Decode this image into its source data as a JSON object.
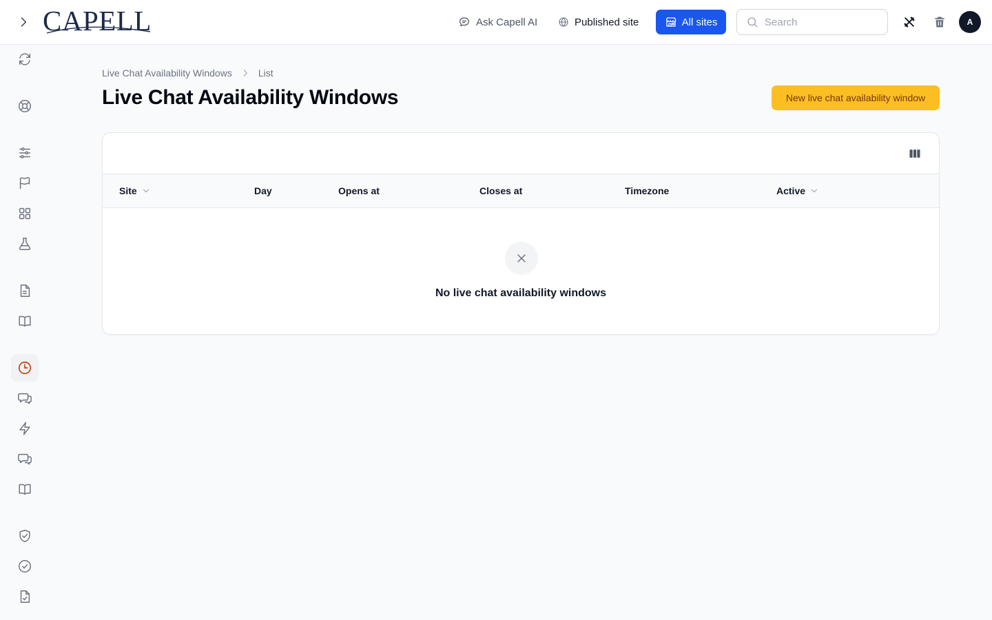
{
  "brand": {
    "logo_text": "CAPELL"
  },
  "topbar": {
    "ask_ai_label": "Ask Capell AI",
    "published_site_label": "Published site",
    "all_sites_label": "All sites",
    "search_placeholder": "Search",
    "search_value": "",
    "avatar_initial": "A",
    "accent_color": "#1a56f0"
  },
  "sidebar": {
    "items": [
      {
        "icon": "refresh-icon",
        "active": false
      },
      {
        "icon": "lifebuoy-icon",
        "active": false
      },
      {
        "icon": "sliders-icon",
        "active": false
      },
      {
        "icon": "flag-icon",
        "active": false
      },
      {
        "icon": "grid-icon",
        "active": false
      },
      {
        "icon": "flask-icon",
        "active": false
      },
      {
        "icon": "document-icon",
        "active": false
      },
      {
        "icon": "book-icon",
        "active": false
      },
      {
        "icon": "clock-icon",
        "active": true
      },
      {
        "icon": "chat-bubbles-icon",
        "active": false
      },
      {
        "icon": "bolt-icon",
        "active": false
      },
      {
        "icon": "chat-bubbles-icon",
        "active": false
      },
      {
        "icon": "book-icon",
        "active": false
      },
      {
        "icon": "shield-check-icon",
        "active": false
      },
      {
        "icon": "check-circle-icon",
        "active": false
      },
      {
        "icon": "document-check-icon",
        "active": false
      }
    ],
    "active_color": "#c2410c"
  },
  "breadcrumb": {
    "parent": "Live Chat Availability Windows",
    "current": "List"
  },
  "page": {
    "title": "Live Chat Availability Windows",
    "new_button_label": "New live chat availability window",
    "new_button_color": "#fbbf24"
  },
  "table": {
    "columns": [
      {
        "label": "Site",
        "sortable": true
      },
      {
        "label": "Day",
        "sortable": false
      },
      {
        "label": "Opens at",
        "sortable": false
      },
      {
        "label": "Closes at",
        "sortable": false
      },
      {
        "label": "Timezone",
        "sortable": false
      },
      {
        "label": "Active",
        "sortable": true
      }
    ],
    "rows": [],
    "empty_message": "No live chat availability windows"
  }
}
